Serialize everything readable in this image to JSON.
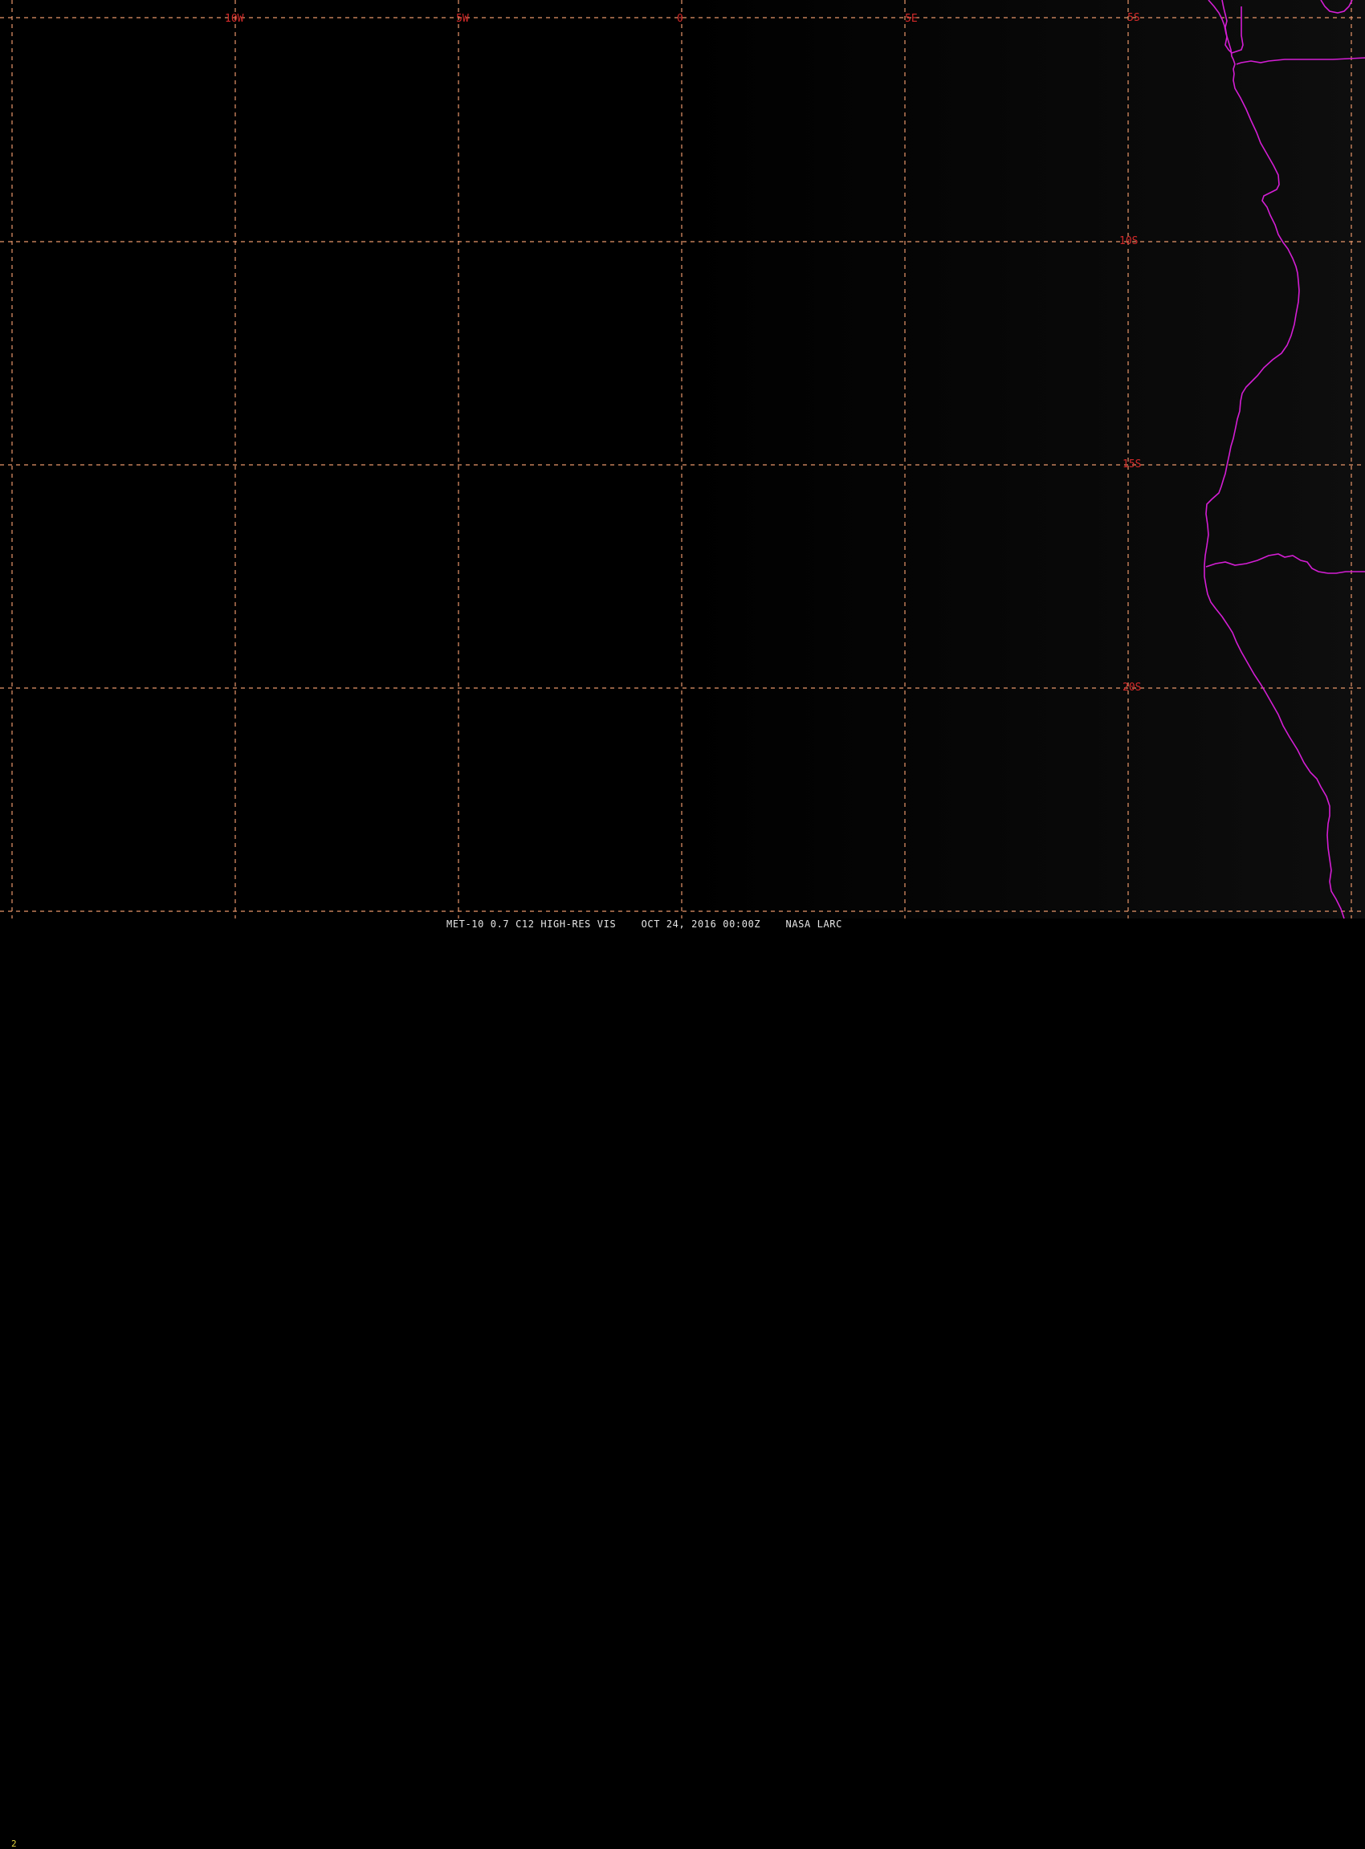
{
  "map": {
    "title": "MET-10 0.7 C12 HIGH-RES VIS    OCT 24, 2016 00:00Z    NASA LARC",
    "frame_number": "2",
    "longitude_labels": [
      "10W",
      "5W",
      "0",
      "5E"
    ],
    "latitude_labels": [
      "5S",
      "10S",
      "15S",
      "20S"
    ],
    "colors": {
      "background": "#000000",
      "graticule": "#e8966a",
      "graticule_labels": "#d42a2a",
      "coastline": "#d41ed4",
      "frame_number": "#e8d640",
      "caption": "#e6e6e6"
    }
  }
}
